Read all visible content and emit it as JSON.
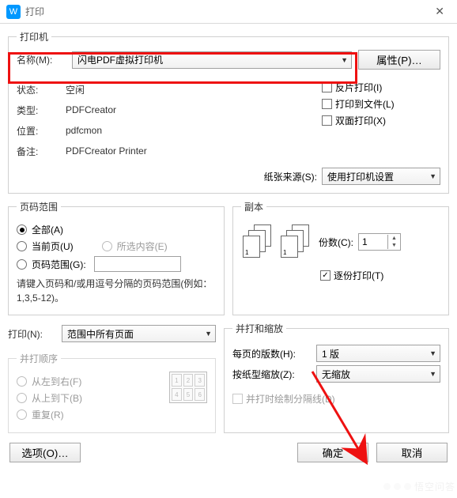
{
  "window": {
    "title": "打印"
  },
  "printer": {
    "group": "打印机",
    "name_label": "名称(M):",
    "name_value": "闪电PDF虚拟打印机",
    "properties_btn": "属性(P)…",
    "status_label": "状态:",
    "status_value": "空闲",
    "type_label": "类型:",
    "type_value": "PDFCreator",
    "where_label": "位置:",
    "where_value": "pdfcmon",
    "comment_label": "备注:",
    "comment_value": "PDFCreator Printer",
    "reverse_print": "反片打印(I)",
    "print_to_file": "打印到文件(L)",
    "duplex_print": "双面打印(X)",
    "paper_source_label": "纸张来源(S):",
    "paper_source_value": "使用打印机设置"
  },
  "page_range": {
    "group": "页码范围",
    "all": "全部(A)",
    "current": "当前页(U)",
    "selection": "所选内容(E)",
    "range": "页码范围(G):",
    "hint": "请键入页码和/或用逗号分隔的页码范围(例如：1,3,5-12)。"
  },
  "copies": {
    "group": "副本",
    "count_label": "份数(C):",
    "count_value": "1",
    "collate": "逐份打印(T)"
  },
  "print_what": {
    "label": "打印(N):",
    "value": "范围中所有页面"
  },
  "merge_order": {
    "group": "并打顺序",
    "lr": "从左到右(F)",
    "tb": "从上到下(B)",
    "repeat": "重复(R)"
  },
  "merge_scale": {
    "group": "并打和缩放",
    "pages_per_sheet_label": "每页的版数(H):",
    "pages_per_sheet_value": "1 版",
    "scale_label": "按纸型缩放(Z):",
    "scale_value": "无缩放",
    "draw_lines": "并打时绘制分隔线(D)"
  },
  "footer": {
    "options_btn": "选项(O)…",
    "ok_btn": "确定",
    "cancel_btn": "取消"
  },
  "watermark": "悟空问答"
}
